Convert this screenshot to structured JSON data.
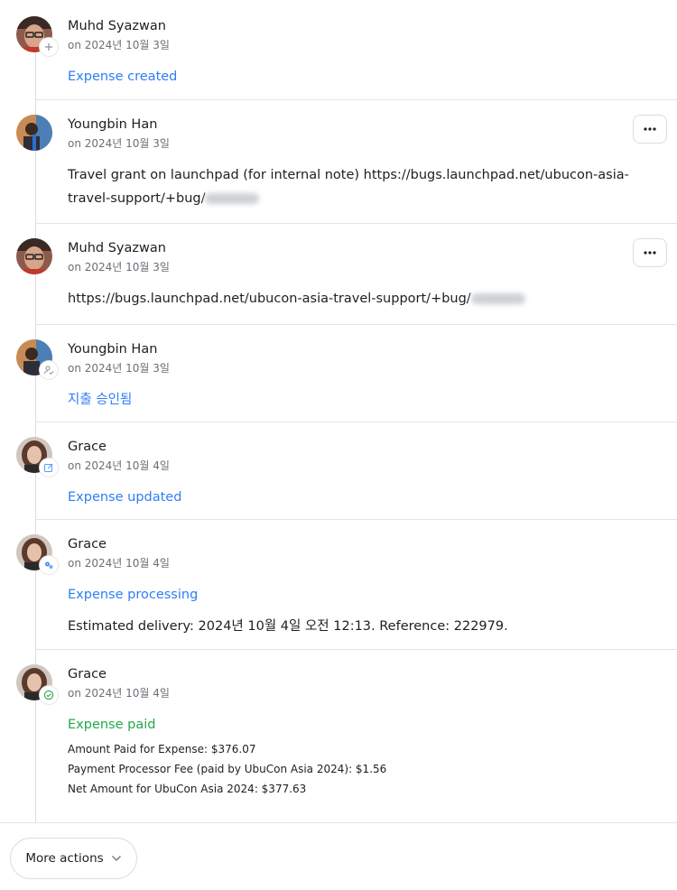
{
  "entries": [
    {
      "name": "Muhd Syazwan",
      "date": "on 2024년 10월 3일",
      "action": "Expense created",
      "badge_icon": "plus-icon"
    },
    {
      "name": "Youngbin Han",
      "date": "on 2024년 10월 3일",
      "comment": "Travel grant on launchpad (for internal note) https://bugs.launchpad.net/ubucon-asia-travel-support/+bug/"
    },
    {
      "name": "Muhd Syazwan",
      "date": "on 2024년 10월 3일",
      "comment": "https://bugs.launchpad.net/ubucon-asia-travel-support/+bug/"
    },
    {
      "name": "Youngbin Han",
      "date": "on 2024년 10월 3일",
      "action": "지출 승인됨",
      "badge_icon": "user-check-icon"
    },
    {
      "name": "Grace",
      "date": "on 2024년 10월 4일",
      "action": "Expense updated",
      "badge_icon": "edit-icon"
    },
    {
      "name": "Grace",
      "date": "on 2024년 10월 4일",
      "action": "Expense processing",
      "badge_icon": "gears-icon",
      "comment": "Estimated delivery: 2024년 10월 4일 오전 12:13. Reference: 222979."
    },
    {
      "name": "Grace",
      "date": "on 2024년 10월 4일",
      "action": "Expense paid",
      "badge_icon": "check-circle-icon",
      "details": [
        "Amount Paid for Expense: $376.07",
        "Payment Processor Fee (paid by UbuCon Asia 2024): $1.56",
        "Net Amount for UbuCon Asia 2024: $377.63"
      ]
    }
  ],
  "more_button_label": "···",
  "footer": {
    "more_actions_label": "More actions",
    "icon": "chevron-down-icon"
  },
  "colors": {
    "link_blue": "#2f7df6",
    "paid_green": "#23a94a",
    "date_gray": "#6b6f76"
  }
}
